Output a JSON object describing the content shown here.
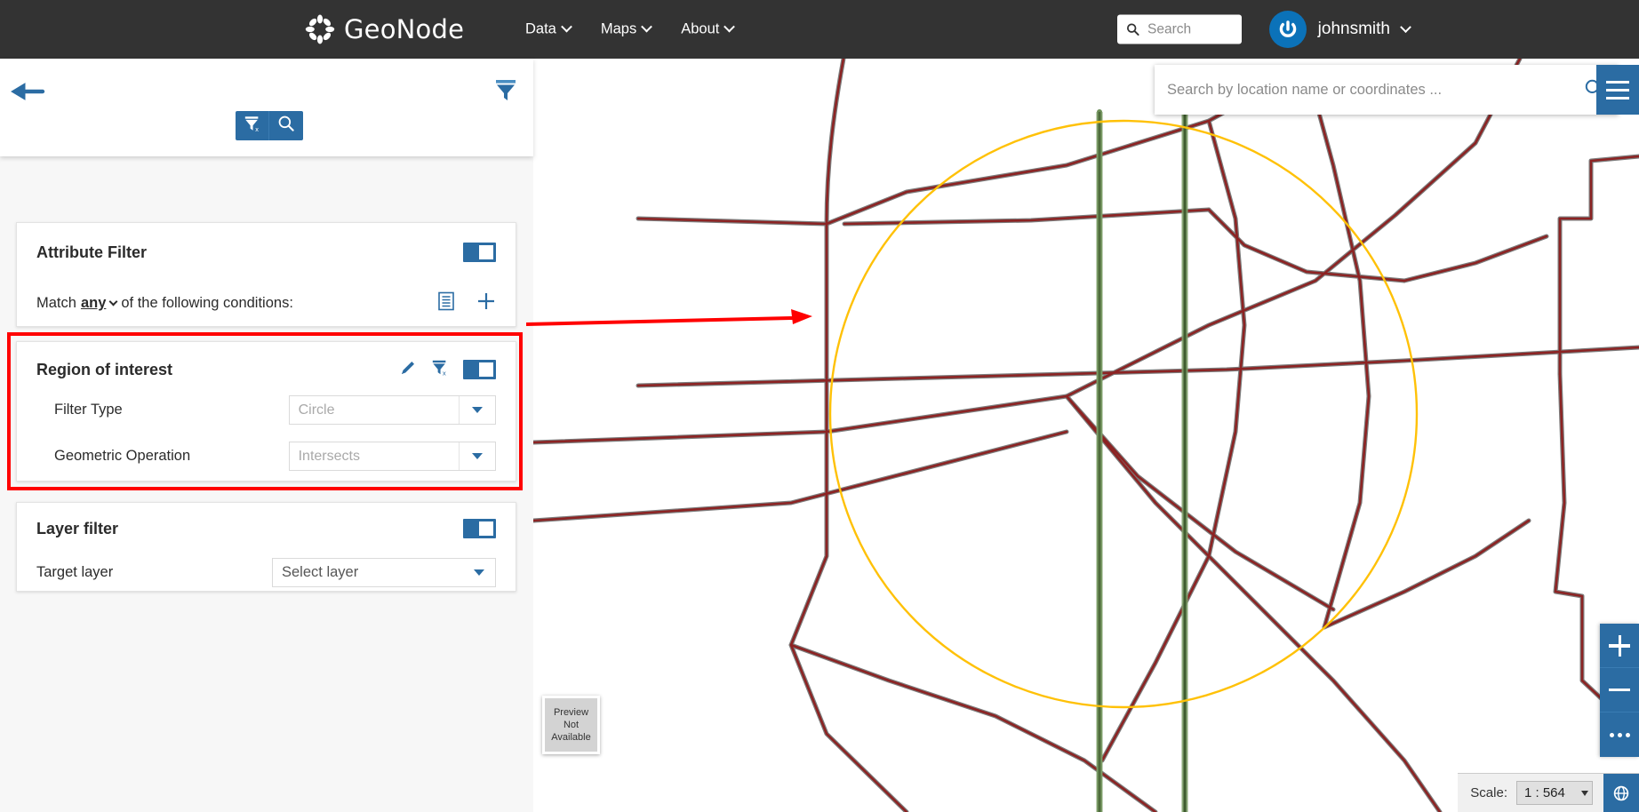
{
  "navbar": {
    "brand": "GeoNode",
    "logo_icon": "geonode-flower-logo-icon",
    "menu": [
      {
        "label": "Data",
        "icon": "chevron-down-icon"
      },
      {
        "label": "Maps",
        "icon": "chevron-down-icon"
      },
      {
        "label": "About",
        "icon": "chevron-down-icon"
      }
    ],
    "search": {
      "placeholder": "Search",
      "icon": "search-icon"
    },
    "account": {
      "username": "johnsmith",
      "avatar_icon": "user-power-avatar-icon",
      "caret_icon": "chevron-down-icon"
    }
  },
  "left_panel": {
    "back_icon": "back-arrow-icon",
    "header_filter_icon": "filter-funnel-icon",
    "toolbar": [
      {
        "name": "clear-filter",
        "icon": "filter-clear-icon"
      },
      {
        "name": "apply-search",
        "icon": "search-icon"
      }
    ],
    "attribute_filter": {
      "title": "Attribute Filter",
      "toggle_on": true,
      "match_prefix": "Match",
      "match_value": "any",
      "match_suffix": "of the following conditions:",
      "group_icon": "add-group-icon",
      "add_icon": "plus-icon"
    },
    "region_of_interest": {
      "title": "Region of interest",
      "toggle_on": true,
      "edit_icon": "pencil-icon",
      "clear_icon": "filter-clear-icon",
      "fields": [
        {
          "label": "Filter Type",
          "value": "Circle",
          "icon": "dropdown-arrow-icon"
        },
        {
          "label": "Geometric Operation",
          "value": "Intersects",
          "icon": "dropdown-arrow-icon"
        }
      ],
      "highlight_color": "#ff0000"
    },
    "layer_filter": {
      "title": "Layer filter",
      "toggle_on": true,
      "target_label": "Target layer",
      "target_value": "Select layer",
      "icon": "dropdown-arrow-icon"
    }
  },
  "map": {
    "search": {
      "placeholder": "Search by location name or coordinates ...",
      "icon": "search-icon"
    },
    "burger_icon": "hamburger-menu-icon",
    "zoom_controls": [
      {
        "name": "zoom-in",
        "label": "+",
        "icon": "plus-icon"
      },
      {
        "name": "zoom-out",
        "label": "−",
        "icon": "minus-icon"
      },
      {
        "name": "more-options",
        "label": "...",
        "icon": "ellipsis-icon"
      }
    ],
    "scale": {
      "label": "Scale:",
      "value": "1 : 564",
      "icon": "dropdown-arrow-icon"
    },
    "crs_icon": "crs-globe-icon",
    "preview_tile": "Preview Not Available",
    "colors": {
      "boundary": "#8c2323",
      "boundary_shadow": "#595959",
      "roi_circle": "#ffc107",
      "green_line": "#5f7f4a",
      "accent": "#2b6ca3"
    }
  }
}
